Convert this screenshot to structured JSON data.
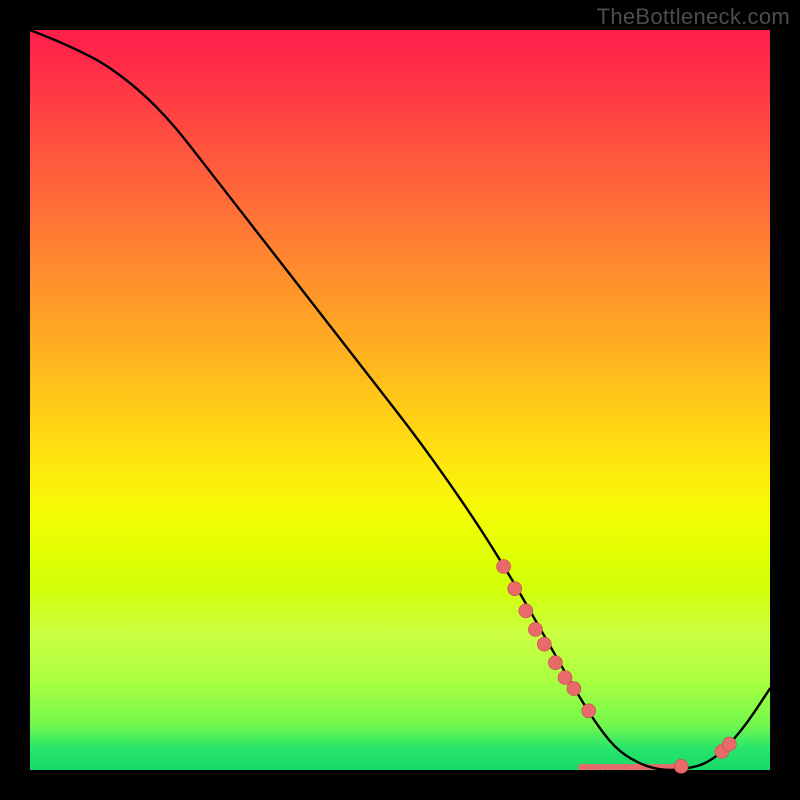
{
  "watermark": "TheBottleneck.com",
  "chart_data": {
    "type": "line",
    "title": "",
    "xlabel": "",
    "ylabel": "",
    "xlim": [
      0,
      100
    ],
    "ylim": [
      0,
      100
    ],
    "series": [
      {
        "name": "curve",
        "x": [
          0,
          5,
          11,
          18,
          25,
          32,
          39,
          46,
          53,
          60,
          65,
          69,
          73,
          76,
          79,
          82,
          85,
          88,
          92,
          96,
          100
        ],
        "values": [
          100,
          98,
          95,
          89,
          80,
          71,
          62,
          53,
          44,
          34,
          26,
          19,
          12,
          7,
          3,
          1,
          0,
          0,
          1,
          5,
          11
        ]
      }
    ],
    "markers": [
      {
        "x": 64.0,
        "y": 27.5
      },
      {
        "x": 65.5,
        "y": 24.5
      },
      {
        "x": 67.0,
        "y": 21.5
      },
      {
        "x": 68.3,
        "y": 19.0
      },
      {
        "x": 69.5,
        "y": 17.0
      },
      {
        "x": 71.0,
        "y": 14.5
      },
      {
        "x": 72.3,
        "y": 12.5
      },
      {
        "x": 73.5,
        "y": 11.0
      },
      {
        "x": 75.5,
        "y": 8.0
      },
      {
        "x": 88.0,
        "y": 0.5
      },
      {
        "x": 93.5,
        "y": 2.5
      },
      {
        "x": 94.5,
        "y": 3.5
      }
    ],
    "bottom_dots": {
      "x_start": 74.5,
      "x_end": 88.0,
      "y": 0.4,
      "count": 24
    }
  },
  "colors": {
    "curve": "#000000",
    "marker_fill": "#e86a6a",
    "marker_stroke": "#c74a4a"
  }
}
